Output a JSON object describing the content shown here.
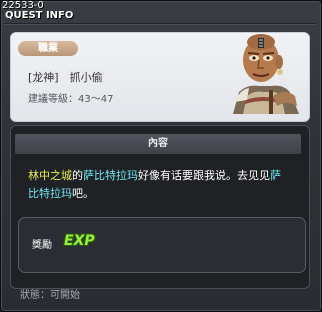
{
  "window": {
    "quest_id": "22533-0",
    "title": "QUEST INFO"
  },
  "header": {
    "job_label": "職業",
    "quest_name": "[龙神]　抓小偷",
    "level_text": "建議等級：43～47",
    "npc_icon": "npc-portrait-icon"
  },
  "content": {
    "section_title": "內容",
    "desc_location": "林中之城",
    "desc_part1": "的",
    "desc_npc": "萨比特拉玛",
    "desc_part2": "好像有话要跟我说。去见见",
    "desc_npc2": "萨比特拉玛",
    "desc_part3": "吧。"
  },
  "reward": {
    "label": "獎勵",
    "exp_text": "EXP"
  },
  "status": {
    "text": "狀態：可開始"
  }
}
